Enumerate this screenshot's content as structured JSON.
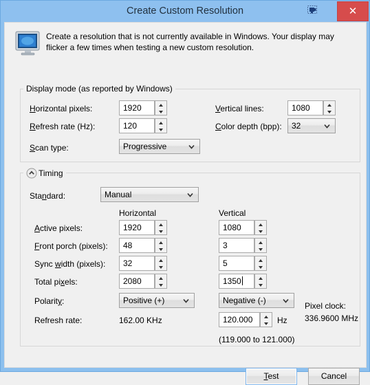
{
  "window": {
    "title": "Create Custom Resolution",
    "help_icon": "window-help-icon",
    "close_label": "✕"
  },
  "header": {
    "icon": "monitor-icon",
    "message": "Create a resolution that is not currently available in Windows. Your display may flicker a few times when testing a new custom resolution."
  },
  "display_mode": {
    "legend": "Display mode (as reported by Windows)",
    "horizontal_pixels_label": "Horizontal pixels:",
    "horizontal_pixels_value": "1920",
    "vertical_lines_label": "Vertical lines:",
    "vertical_lines_value": "1080",
    "refresh_rate_label": "Refresh rate (Hz):",
    "refresh_rate_value": "120",
    "color_depth_label": "Color depth (bpp):",
    "color_depth_value": "32",
    "scan_type_label": "Scan type:",
    "scan_type_value": "Progressive"
  },
  "timing": {
    "legend": "Timing",
    "collapse_icon": "chevron-up-circle-icon",
    "standard_label": "Standard:",
    "standard_value": "Manual",
    "col_horizontal": "Horizontal",
    "col_vertical": "Vertical",
    "rows": [
      {
        "label": "Active pixels:",
        "horizontal": "1920",
        "vertical": "1080"
      },
      {
        "label": "Front porch (pixels):",
        "horizontal": "48",
        "vertical": "3"
      },
      {
        "label": "Sync width (pixels):",
        "horizontal": "32",
        "vertical": "5"
      },
      {
        "label": "Total pixels:",
        "horizontal": "2080",
        "vertical": "1350"
      }
    ],
    "polarity_label": "Polarity:",
    "polarity_horizontal": "Positive (+)",
    "polarity_vertical": "Negative (-)",
    "refresh_rate_label": "Refresh rate:",
    "refresh_rate_horizontal": "162.00 KHz",
    "refresh_rate_vertical": "120.000",
    "refresh_rate_unit": "Hz",
    "refresh_rate_range": "(119.000 to 121.000)",
    "pixel_clock_label": "Pixel clock:",
    "pixel_clock_value": "336.9600 MHz"
  },
  "buttons": {
    "test": "Test",
    "cancel": "Cancel"
  },
  "colors": {
    "titlebar": "#8ec0ef",
    "close": "#d64c4c",
    "client": "#f0f0f0",
    "focus_border": "#7eb4ea"
  }
}
